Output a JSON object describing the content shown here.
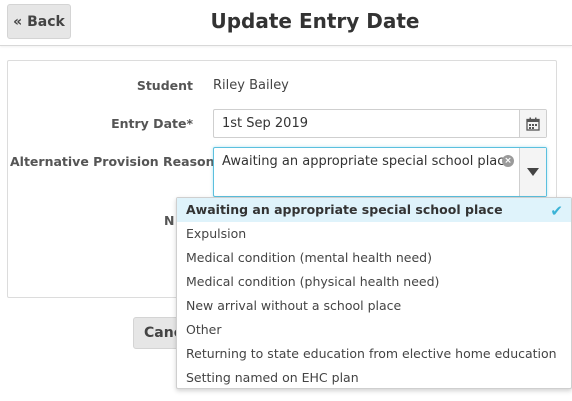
{
  "header": {
    "back_label": "« Back",
    "title": "Update Entry Date"
  },
  "form": {
    "student_label": "Student",
    "student_value": "Riley Bailey",
    "entry_date_label": "Entry Date*",
    "entry_date_value": "1st Sep 2019",
    "reason_label": "Alternative Provision Reason",
    "reason_value": "Awaiting an appropriate special school place",
    "obscured_label_fragment": "N",
    "cancel_label": "Cancel"
  },
  "dropdown": {
    "selected_index": 0,
    "options": [
      "Awaiting an appropriate special school place",
      "Expulsion",
      "Medical condition (mental health need)",
      "Medical condition (physical health need)",
      "New arrival without a school place",
      "Other",
      "Returning to state education from elective home education",
      "Setting named on EHC plan"
    ]
  },
  "icons": {
    "calendar": "calendar-icon",
    "clear": "clear-icon",
    "caret": "chevron-down-icon",
    "check": "check-icon"
  },
  "colors": {
    "focus_border": "#5bc0de",
    "selected_bg": "#dff3fb",
    "check": "#3bb3d6"
  }
}
